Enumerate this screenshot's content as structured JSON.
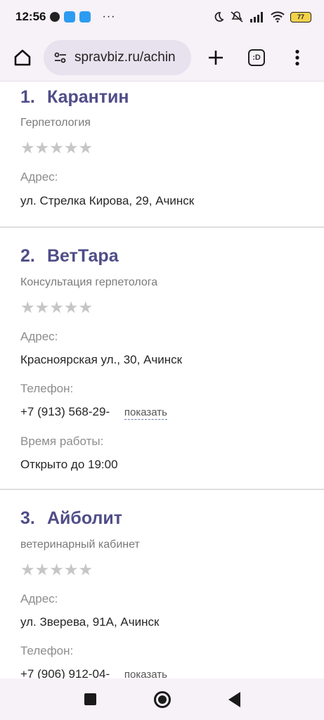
{
  "status_bar": {
    "time": "12:56",
    "battery": "77"
  },
  "toolbar": {
    "url": "spravbiz.ru/achin",
    "tab_count": ":D"
  },
  "listings": [
    {
      "number": "1.",
      "name": "Карантин",
      "category": "Герпетология",
      "address_label": "Адрес:",
      "address": "ул. Стрелка Кирова, 29, Ачинск"
    },
    {
      "number": "2.",
      "name": "ВетТара",
      "category": "Консультация герпетолога",
      "address_label": "Адрес:",
      "address": "Красноярская ул., 30, Ачинск",
      "phone_label": "Телефон:",
      "phone": "+7 (913) 568-29-",
      "show_label": "показать",
      "hours_label": "Время работы:",
      "hours": "Открыто до 19:00"
    },
    {
      "number": "3.",
      "name": "Айболит",
      "category": "ветеринарный кабинет",
      "address_label": "Адрес:",
      "address": "ул. Зверева, 91А, Ачинск",
      "phone_label": "Телефон:",
      "phone": "+7 (906) 912-04-",
      "show_label": "показать"
    }
  ],
  "rating_stars": "★★★★★",
  "icons": {
    "home": "home-icon",
    "site_settings": "site-settings-icon",
    "new_tab": "plus-icon",
    "menu": "more-vert-icon",
    "recents": "square-icon",
    "nav_home": "circle-icon",
    "back": "triangle-back-icon"
  },
  "colors": {
    "title": "#4f4d88",
    "bar_bg": "#f7f1f8",
    "star": "#c6c6c6"
  }
}
